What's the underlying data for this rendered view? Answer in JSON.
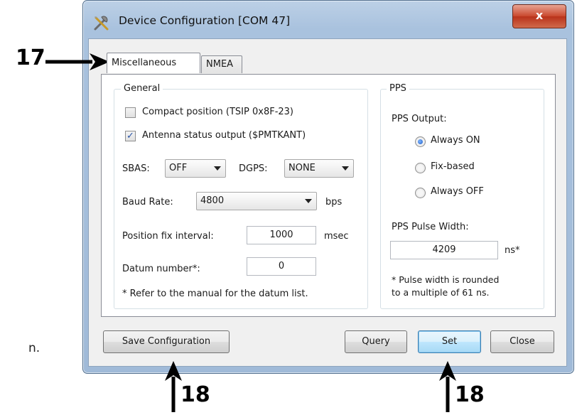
{
  "doc_fragment": "n.",
  "window": {
    "title": "Device Configuration [COM 47]",
    "close_label": "x"
  },
  "tabs": [
    {
      "label": "Miscellaneous",
      "active": true
    },
    {
      "label": "NMEA",
      "active": false
    }
  ],
  "general": {
    "label": "General",
    "compact_position": {
      "label": "Compact position (TSIP 0x8F-23)",
      "checked": false
    },
    "antenna_status": {
      "label": "Antenna status output ($PMTKANT)",
      "checked": true
    },
    "sbas": {
      "label": "SBAS:",
      "value": "OFF"
    },
    "dgps": {
      "label": "DGPS:",
      "value": "NONE"
    },
    "baud_rate": {
      "label": "Baud Rate:",
      "value": "4800",
      "unit": "bps"
    },
    "position_fix": {
      "label": "Position fix interval:",
      "value": "1000",
      "unit": "msec"
    },
    "datum": {
      "label": "Datum number*:",
      "value": "0"
    },
    "datum_note": "* Refer to the manual for the datum list."
  },
  "pps": {
    "label": "PPS",
    "output_label": "PPS Output:",
    "options": [
      {
        "label": "Always ON",
        "selected": true
      },
      {
        "label": "Fix-based",
        "selected": false
      },
      {
        "label": "Always OFF",
        "selected": false
      }
    ],
    "pulse_width_label": "PPS Pulse Width:",
    "pulse_width_value": "4209",
    "pulse_width_unit": "ns*",
    "note_line1": "* Pulse width is rounded",
    "note_line2": "to a multiple of 61 ns."
  },
  "buttons": {
    "save": "Save Configuration",
    "query": "Query",
    "set": "Set",
    "close": "Close"
  },
  "callouts": {
    "tab": "17",
    "save": "18",
    "set": "18"
  }
}
